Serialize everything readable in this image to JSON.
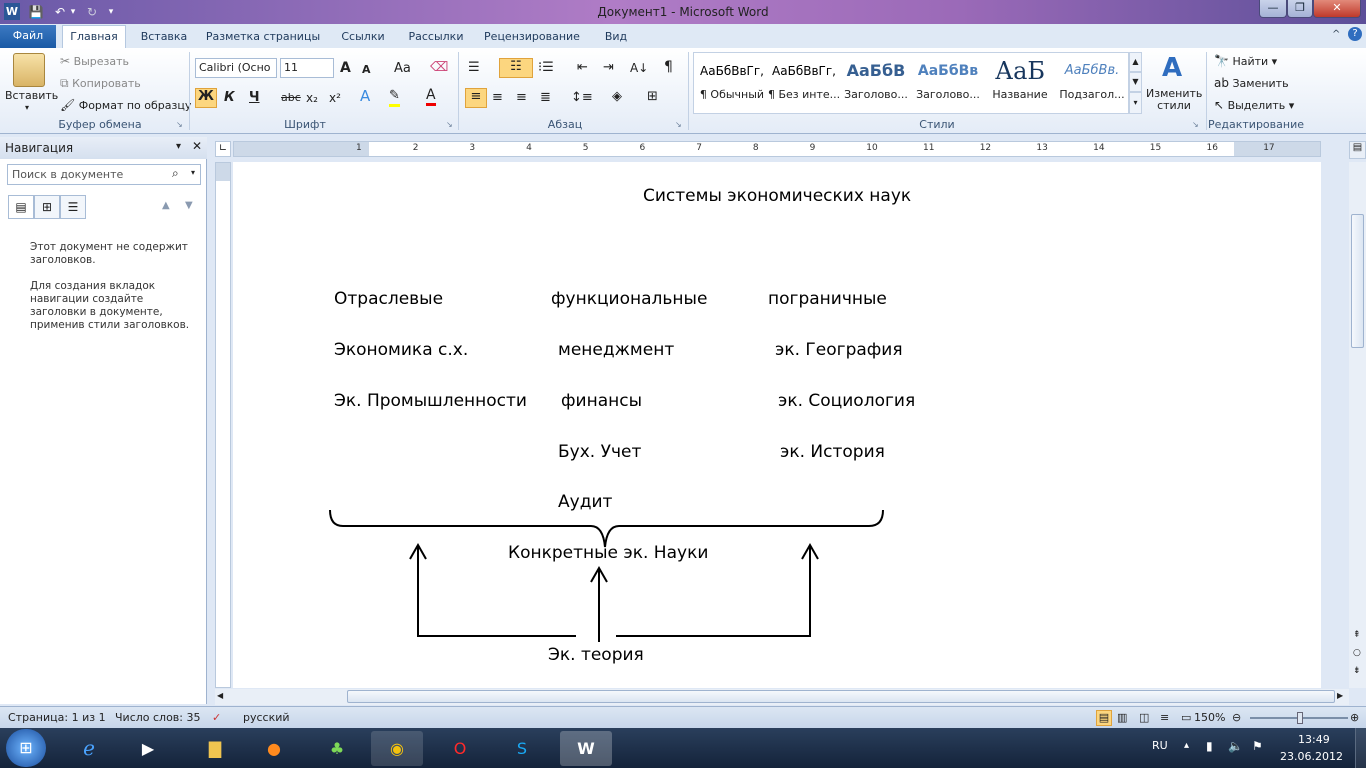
{
  "window": {
    "title": "Документ1 - Microsoft Word",
    "app_letter": "W"
  },
  "qat": {
    "save_icon": "save-icon",
    "undo_icon": "undo-icon",
    "redo_icon": "redo-icon"
  },
  "tabs": [
    "Файл",
    "Главная",
    "Вставка",
    "Разметка страницы",
    "Ссылки",
    "Рассылки",
    "Рецензирование",
    "Вид"
  ],
  "clipboard": {
    "paste": "Вставить",
    "cut": "Вырезать",
    "copy": "Копировать",
    "format": "Формат по образцу",
    "group": "Буфер обмена"
  },
  "font": {
    "name": "Calibri (Осно",
    "size": "11",
    "group": "Шрифт",
    "bold": "Ж",
    "italic": "К",
    "underline": "Ч",
    "strike": "abc",
    "sub": "x₂",
    "sup": "x²",
    "grow": "A",
    "shrink": "A",
    "case": "Aa",
    "color": "A"
  },
  "paragraph": {
    "group": "Абзац",
    "pilcrow": "¶"
  },
  "styles": {
    "group": "Стили",
    "items": [
      {
        "preview": "АаБбВвГг,",
        "label": "¶ Обычный"
      },
      {
        "preview": "АаБбВвГг,",
        "label": "¶ Без инте..."
      },
      {
        "preview": "АаБбВ",
        "label": "Заголово..."
      },
      {
        "preview": "АаБбВв",
        "label": "Заголово..."
      },
      {
        "preview": "АаБ",
        "label": "Название"
      },
      {
        "preview": "АаБбВв.",
        "label": "Подзагол..."
      }
    ],
    "change": "Изменить стили"
  },
  "editing": {
    "group": "Редактирование",
    "find": "Найти",
    "replace": "Заменить",
    "select": "Выделить"
  },
  "nav": {
    "title": "Навигация",
    "search_placeholder": "Поиск в документе",
    "msg1": "Этот документ не содержит заголовков.",
    "msg2": "Для создания вкладок навигации создайте заголовки в документе, применив стили заголовков."
  },
  "document": {
    "title": "Системы экономических наук",
    "col1": [
      "Отраслевые",
      "Экономика с.х.",
      "Эк. Промышленности"
    ],
    "col2": [
      "функциональные",
      "менеджмент",
      "финансы",
      "Бух. Учет",
      "Аудит"
    ],
    "col3": [
      "пограничные",
      "эк. География",
      "эк. Социология",
      "эк. История"
    ],
    "concrete": "Конкретные эк. Науки",
    "theory": "Эк. теория"
  },
  "ruler": {
    "marks": [
      "1",
      "2",
      "3",
      "4",
      "5",
      "6",
      "7",
      "8",
      "9",
      "10",
      "11",
      "12",
      "13",
      "14",
      "15",
      "16",
      "17"
    ]
  },
  "status": {
    "page": "Страница: 1 из 1",
    "words": "Число слов: 35",
    "lang": "русский",
    "zoom": "150%"
  },
  "tray": {
    "lang": "RU",
    "time": "13:49",
    "date": "23.06.2012"
  }
}
